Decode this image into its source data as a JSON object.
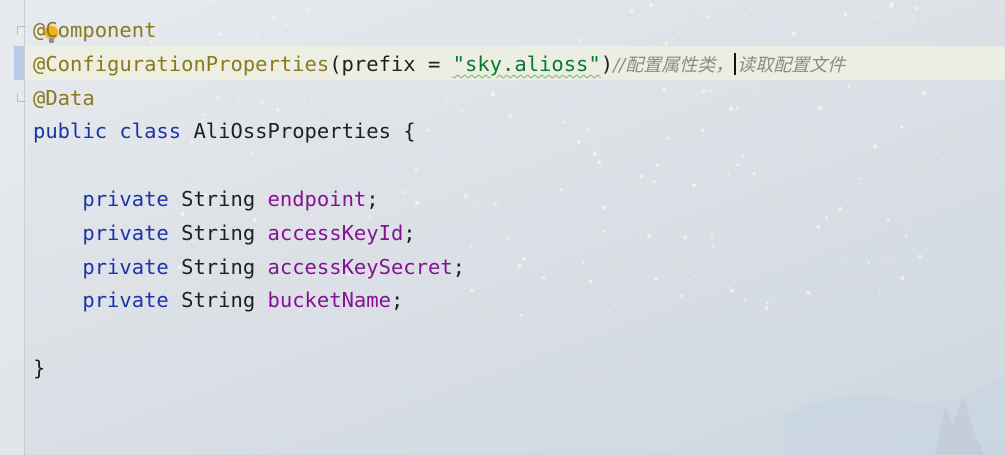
{
  "editor": {
    "lines": [
      {
        "tokens": [
          {
            "text": "@",
            "cls": "ann"
          },
          {
            "text": "Component",
            "cls": "ann"
          }
        ]
      },
      {
        "tokens": [
          {
            "text": "@ConfigurationProperties",
            "cls": "ann"
          },
          {
            "text": "(prefix = ",
            "cls": ""
          },
          {
            "text": "\"sky.alioss\"",
            "cls": "str"
          },
          {
            "text": ")",
            "cls": ""
          },
          {
            "text": "//配置属性类，",
            "cls": "comment"
          },
          {
            "text": "",
            "cls": "caret"
          },
          {
            "text": "读取配置文件",
            "cls": "comment"
          }
        ]
      },
      {
        "tokens": [
          {
            "text": "@Data",
            "cls": "ann"
          }
        ]
      },
      {
        "tokens": [
          {
            "text": "public",
            "cls": "kw"
          },
          {
            "text": " ",
            "cls": ""
          },
          {
            "text": "class",
            "cls": "kw"
          },
          {
            "text": " AliOssProperties {",
            "cls": ""
          }
        ]
      },
      {
        "tokens": []
      },
      {
        "tokens": [
          {
            "text": "    ",
            "cls": ""
          },
          {
            "text": "private",
            "cls": "kw"
          },
          {
            "text": " String ",
            "cls": ""
          },
          {
            "text": "endpoint",
            "cls": "field"
          },
          {
            "text": ";",
            "cls": ""
          }
        ]
      },
      {
        "tokens": [
          {
            "text": "    ",
            "cls": ""
          },
          {
            "text": "private",
            "cls": "kw"
          },
          {
            "text": " String ",
            "cls": ""
          },
          {
            "text": "accessKeyId",
            "cls": "field"
          },
          {
            "text": ";",
            "cls": ""
          }
        ]
      },
      {
        "tokens": [
          {
            "text": "    ",
            "cls": ""
          },
          {
            "text": "private",
            "cls": "kw"
          },
          {
            "text": " String ",
            "cls": ""
          },
          {
            "text": "accessKeySecret",
            "cls": "field"
          },
          {
            "text": ";",
            "cls": ""
          }
        ]
      },
      {
        "tokens": [
          {
            "text": "    ",
            "cls": ""
          },
          {
            "text": "private",
            "cls": "kw"
          },
          {
            "text": " String ",
            "cls": ""
          },
          {
            "text": "bucketName",
            "cls": "field"
          },
          {
            "text": ";",
            "cls": ""
          }
        ]
      },
      {
        "tokens": []
      },
      {
        "tokens": [
          {
            "text": "}",
            "cls": ""
          }
        ]
      }
    ]
  },
  "icons": {
    "intention_bulb": "lightbulb-icon",
    "fold_start": "fold-start-icon",
    "fold_end": "fold-end-icon"
  },
  "colors": {
    "annotation": "#8a7a1e",
    "keyword": "#1b35a8",
    "field": "#871094",
    "string": "#087a2b",
    "comment": "#8a8a8a"
  }
}
